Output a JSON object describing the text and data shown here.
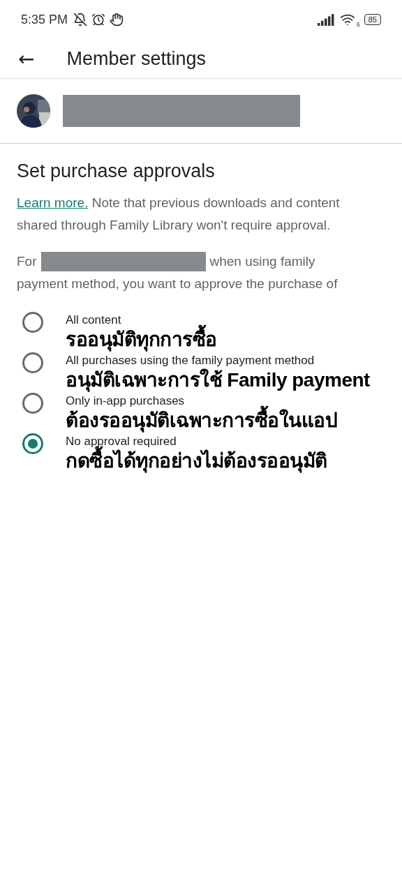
{
  "status_bar": {
    "time": "5:35 PM",
    "wifi_label": "6",
    "battery": "85"
  },
  "app_bar": {
    "back": "←",
    "title": "Member settings"
  },
  "member": {
    "name_redacted": true
  },
  "section": {
    "title": "Set purchase approvals",
    "link": "Learn more.",
    "note": "Note that previous downloads and content shared through Family Library won't require approval.",
    "lead": "For",
    "name_redacted": true,
    "rest_line1": "when using family",
    "rest": "payment method, you want to approve the purchase of"
  },
  "options": [
    {
      "label": "All content",
      "caption": "รออนุมัติทุกการซื้อ",
      "selected": false
    },
    {
      "label": "All purchases using the family payment method",
      "caption": "อนุมัติเฉพาะการใช้ Family payment",
      "selected": false
    },
    {
      "label": "Only in-app purchases",
      "caption": "ต้องรออนุมัติเฉพาะการซื้อในแอป",
      "selected": false
    },
    {
      "label": "No approval required",
      "caption": "กดซื้อได้ทุกอย่างไม่ต้องรออนุมัติ",
      "selected": true
    }
  ]
}
